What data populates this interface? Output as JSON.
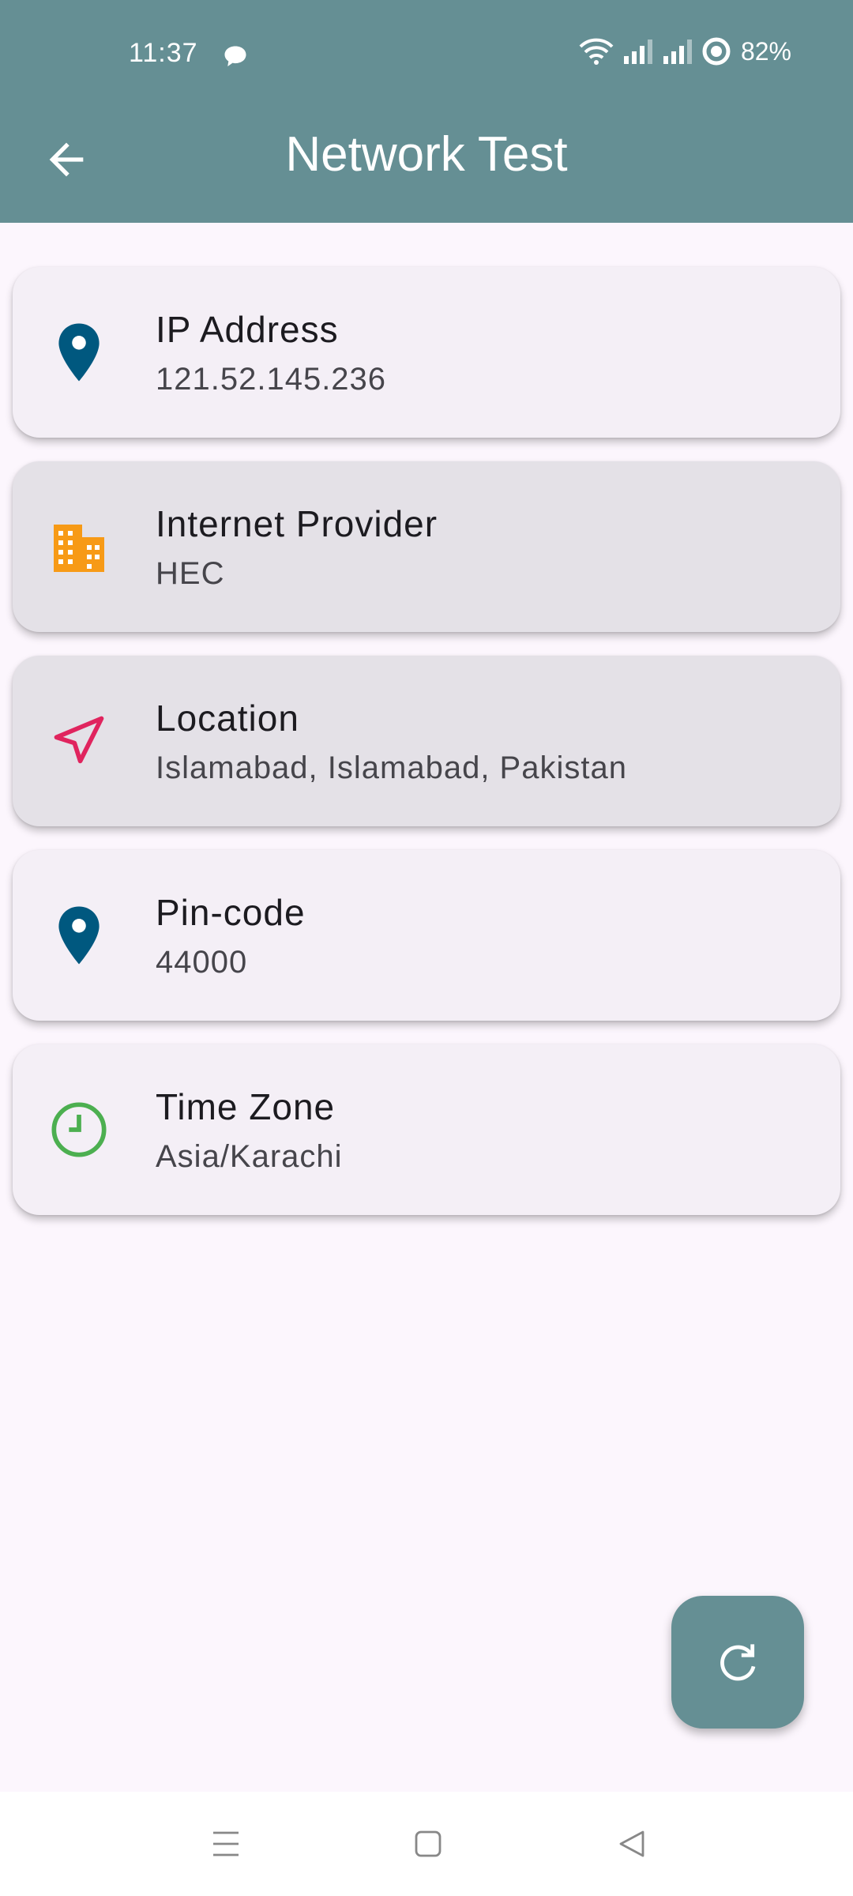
{
  "status_bar": {
    "time": "11:37",
    "battery": "82%",
    "icons": [
      "chat-notification-icon",
      "wifi-icon",
      "signal-icon",
      "signal-icon",
      "battery-ring-icon"
    ]
  },
  "header": {
    "title": "Network Test",
    "back_icon": "arrow-left-icon"
  },
  "cards": [
    {
      "label": "IP Address",
      "value": "121.52.145.236",
      "icon": "map-pin-icon",
      "icon_color": "#00587f"
    },
    {
      "label": "Internet Provider",
      "value": "HEC",
      "icon": "building-icon",
      "icon_color": "#f79a16"
    },
    {
      "label": "Location",
      "value": "Islamabad, Islamabad, Pakistan",
      "icon": "navigation-arrow-icon",
      "icon_color": "#e0245e"
    },
    {
      "label": "Pin-code",
      "value": "44000",
      "icon": "map-pin-icon",
      "icon_color": "#00587f"
    },
    {
      "label": "Time Zone",
      "value": "Asia/Karachi",
      "icon": "clock-icon",
      "icon_color": "#4caf50"
    }
  ],
  "fab": {
    "icon": "refresh-icon"
  },
  "colors": {
    "accent": "#658f94",
    "background": "#fcf6fd",
    "card": "#f4eff6"
  },
  "nav_bar": {
    "icons": [
      "menu-icon",
      "home-square-icon",
      "back-triangle-icon"
    ]
  }
}
